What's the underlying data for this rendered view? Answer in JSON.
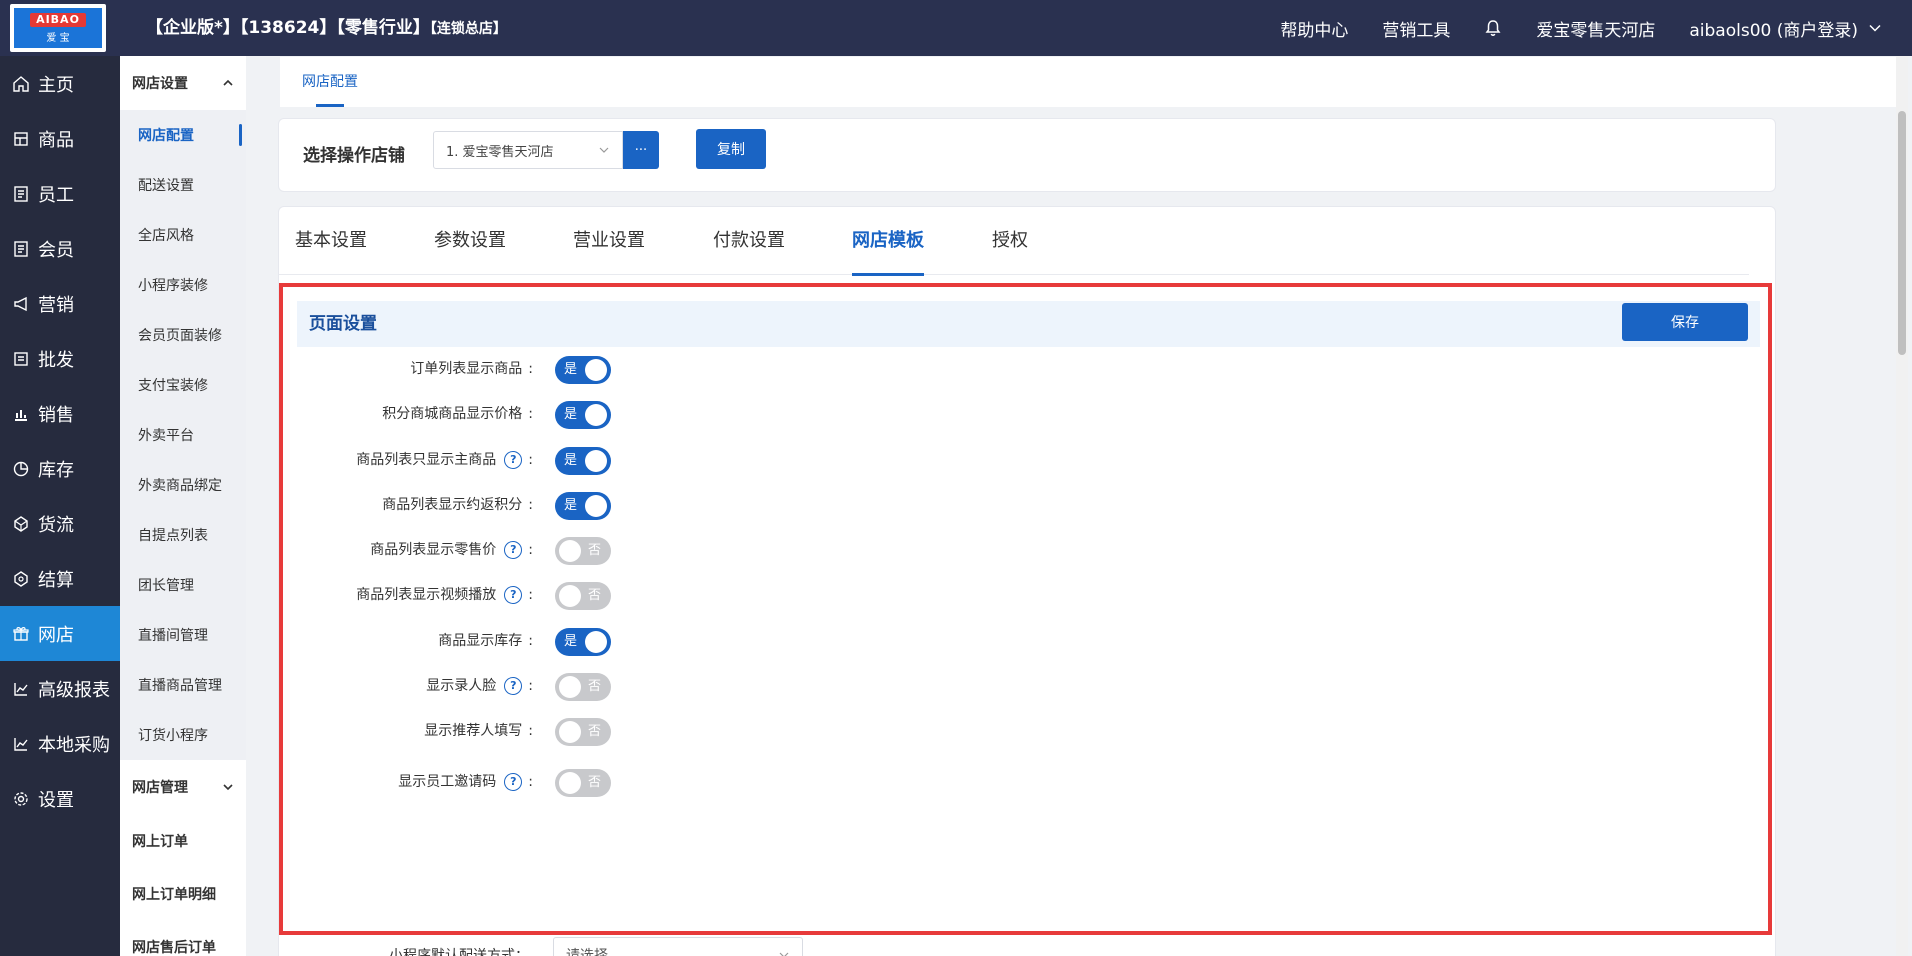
{
  "logo": {
    "line1": "AIBAO",
    "line2": "爱 宝"
  },
  "header": {
    "title_main": "【企业版*】【138624】【零售行业】",
    "title_small": "【连锁总店】",
    "help": "帮助中心",
    "marketing_tools": "营销工具",
    "store_name": "爱宝零售天河店",
    "user": "aibaols00 (商户登录)"
  },
  "leftnav": {
    "items": [
      {
        "label": "主页",
        "icon": "home-icon"
      },
      {
        "label": "商品",
        "icon": "goods-icon"
      },
      {
        "label": "员工",
        "icon": "staff-icon"
      },
      {
        "label": "会员",
        "icon": "member-icon"
      },
      {
        "label": "营销",
        "icon": "megaphone-icon"
      },
      {
        "label": "批发",
        "icon": "list-icon"
      },
      {
        "label": "销售",
        "icon": "bar-chart-icon"
      },
      {
        "label": "库存",
        "icon": "pie-icon"
      },
      {
        "label": "货流",
        "icon": "flow-icon"
      },
      {
        "label": "结算",
        "icon": "settle-icon"
      },
      {
        "label": "网店",
        "icon": "gift-icon"
      },
      {
        "label": "高级报表",
        "icon": "line-chart-icon"
      },
      {
        "label": "本地采购",
        "icon": "line-chart-icon"
      },
      {
        "label": "设置",
        "icon": "gear-icon"
      }
    ],
    "active_index": 10
  },
  "subnav": {
    "group1": "网店设置",
    "group1_items": [
      "网店配置",
      "配送设置",
      "全店风格",
      "小程序装修",
      "会员页面装修",
      "支付宝装修",
      "外卖平台",
      "外卖商品绑定",
      "自提点列表",
      "团长管理",
      "直播间管理",
      "直播商品管理",
      "订货小程序"
    ],
    "group2": "网店管理",
    "group2_items": [
      "网上订单",
      "网上订单明细",
      "网店售后订单"
    ]
  },
  "pagetab": {
    "label": "网店配置"
  },
  "store_selector": {
    "label": "选择操作店铺",
    "value": "1. 爱宝零售天河店",
    "more": "···",
    "copy": "复制"
  },
  "tabs": [
    "基本设置",
    "参数设置",
    "营业设置",
    "付款设置",
    "网店模板",
    "授权"
  ],
  "active_tab": 4,
  "section": {
    "title": "页面设置",
    "save": "保存"
  },
  "switch_labels": {
    "on": "是",
    "off": "否"
  },
  "settings": [
    {
      "label": "订单列表显示商品",
      "help": false,
      "on": true
    },
    {
      "label": "积分商城商品显示价格",
      "help": false,
      "on": true
    },
    {
      "label": "商品列表只显示主商品",
      "help": true,
      "on": true
    },
    {
      "label": "商品列表显示约返积分",
      "help": false,
      "on": true
    },
    {
      "label": "商品列表显示零售价",
      "help": true,
      "on": false
    },
    {
      "label": "商品列表显示视频播放",
      "help": true,
      "on": false
    },
    {
      "label": "商品显示库存",
      "help": false,
      "on": true
    },
    {
      "label": "显示录人脸",
      "help": true,
      "on": false
    },
    {
      "label": "显示推荐人填写",
      "help": false,
      "on": false
    },
    {
      "label": "显示员工邀请码",
      "help": true,
      "on": false
    }
  ],
  "bottom": {
    "label": "小程序默认配送方式：",
    "placeholder": "请选择"
  },
  "colors": {
    "accent": "#1a64c4",
    "header_bg": "#2a3150",
    "nav_bg": "#262b3e",
    "nav_active": "#1e87d6",
    "highlight": "#e73a3a"
  }
}
